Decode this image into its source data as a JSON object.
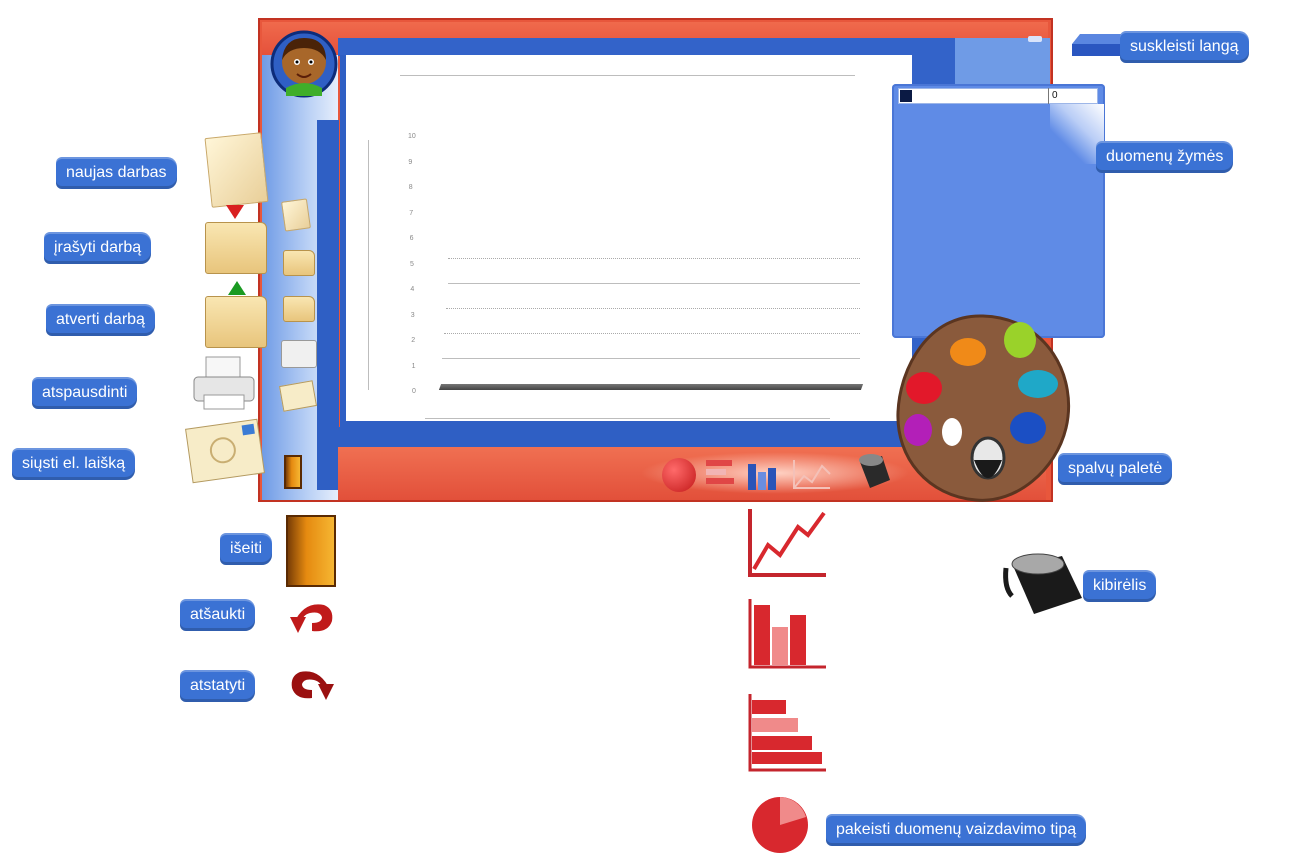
{
  "labels": {
    "collapse_window": "suskleisti langą",
    "data_markers": "duomenų žymės",
    "new_work": "naujas darbas",
    "save_work": "įrašyti darbą",
    "open_work": "atverti darbą",
    "print": "atspausdinti",
    "send_email": "siųsti el. laišką",
    "exit": "išeiti",
    "undo": "atšaukti",
    "redo": "atstatyti",
    "color_palette": "spalvų paletė",
    "bucket": "kibirėlis",
    "change_view_type": "pakeisti duomenų vaizdavimo tipą"
  },
  "data_panel": {
    "first_value": "0"
  },
  "chart": {
    "y_ticks": [
      "10",
      "9",
      "8",
      "7",
      "6",
      "5",
      "4",
      "3",
      "2",
      "1",
      "0"
    ]
  },
  "icons": {
    "avatar": "boy-avatar-icon",
    "new_work": "blank-paper-icon",
    "save_work": "folder-save-icon",
    "open_work": "folder-open-icon",
    "print": "printer-icon",
    "send_email": "envelope-icon",
    "exit": "door-icon",
    "undo": "undo-arrow-icon",
    "redo": "redo-arrow-icon",
    "palette": "paint-palette-icon",
    "bucket": "paint-bucket-icon",
    "pie": "pie-chart-icon",
    "bar_horizontal": "horizontal-bar-chart-icon",
    "bar_vertical": "vertical-bar-chart-icon",
    "line": "line-chart-icon",
    "collapse": "collapse-window-icon"
  },
  "colors": {
    "frame": "#e8573c",
    "blue_panel": "#5f8be6",
    "callout": "#3b72d4",
    "chart_red": "#d8282e"
  }
}
